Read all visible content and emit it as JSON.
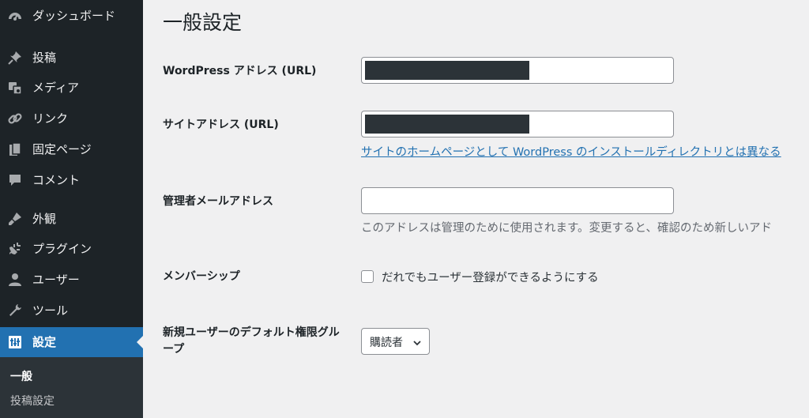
{
  "sidebar": {
    "items": [
      {
        "label": "ダッシュボード",
        "icon": "dashboard-icon"
      },
      {
        "label": "投稿",
        "icon": "pin-icon"
      },
      {
        "label": "メディア",
        "icon": "media-icon"
      },
      {
        "label": "リンク",
        "icon": "link-icon"
      },
      {
        "label": "固定ページ",
        "icon": "pages-icon"
      },
      {
        "label": "コメント",
        "icon": "comment-icon"
      },
      {
        "label": "外観",
        "icon": "appearance-icon"
      },
      {
        "label": "プラグイン",
        "icon": "plugin-icon"
      },
      {
        "label": "ユーザー",
        "icon": "user-icon"
      },
      {
        "label": "ツール",
        "icon": "wrench-icon"
      },
      {
        "label": "設定",
        "icon": "settings-icon",
        "current": true
      }
    ],
    "submenu": [
      {
        "label": "一般",
        "current": true
      },
      {
        "label": "投稿設定"
      }
    ]
  },
  "page": {
    "title": "一般設定",
    "wp_address_label": "WordPress アドレス (URL)",
    "site_address_label": "サイトアドレス (URL)",
    "site_address_help": "サイトのホームページとして WordPress のインストールディレクトリとは異なる",
    "admin_email_label": "管理者メールアドレス",
    "admin_email_value": "",
    "admin_email_help": "このアドレスは管理のために使用されます。変更すると、確認のため新しいアド",
    "membership_label": "メンバーシップ",
    "membership_checkbox_label": "だれでもユーザー登録ができるようにする",
    "membership_checked": false,
    "default_role_label": "新規ユーザーのデフォルト権限グループ",
    "default_role_value": "購読者"
  },
  "colors": {
    "sidebar_bg": "#1d2327",
    "accent": "#2271b1",
    "page_bg": "#f0f0f1"
  }
}
